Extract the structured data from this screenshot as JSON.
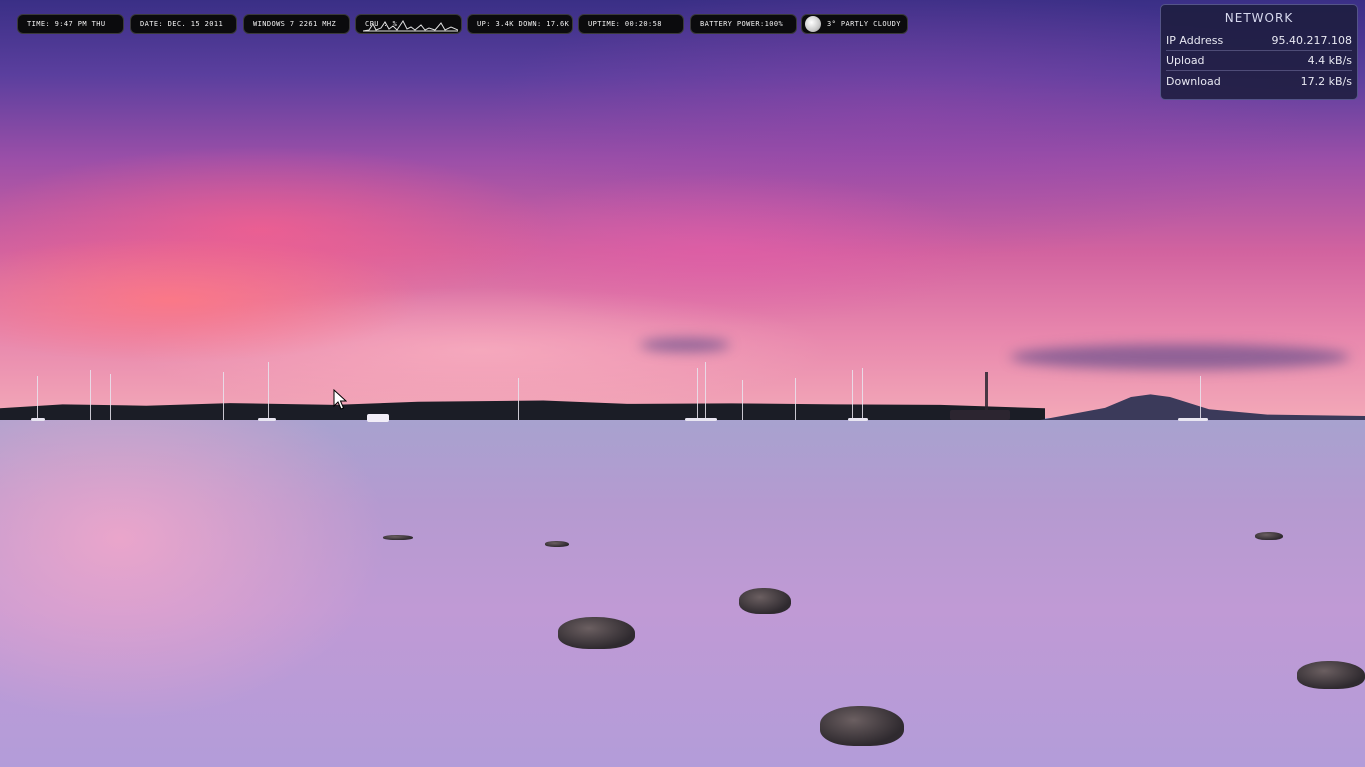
{
  "taskbar": {
    "time": "TIME: 9:47 PM  THU",
    "date": "DATE: DEC. 15  2011",
    "system": "WINDOWS 7  2261 MHZ",
    "cpu": "CPU : %",
    "network_speed": "UP: 3.4K  DOWN: 17.6K",
    "uptime": "UPTIME:    00:20:58",
    "battery": "BATTERY POWER:100%",
    "weather": "3° PARTLY CLOUDY"
  },
  "network": {
    "title": "NETWORK",
    "rows": [
      {
        "label": "IP Address",
        "value": "95.40.217.108"
      },
      {
        "label": "Upload",
        "value": "4.4 kB/s"
      },
      {
        "label": "Download",
        "value": "17.2 kB/s"
      }
    ]
  },
  "icons": {
    "weather": "partly-cloudy-icon",
    "cursor": "mouse-pointer-icon"
  },
  "colors": {
    "pill_background": "#0b0b0d",
    "panel_background": "#1c1c3e"
  }
}
